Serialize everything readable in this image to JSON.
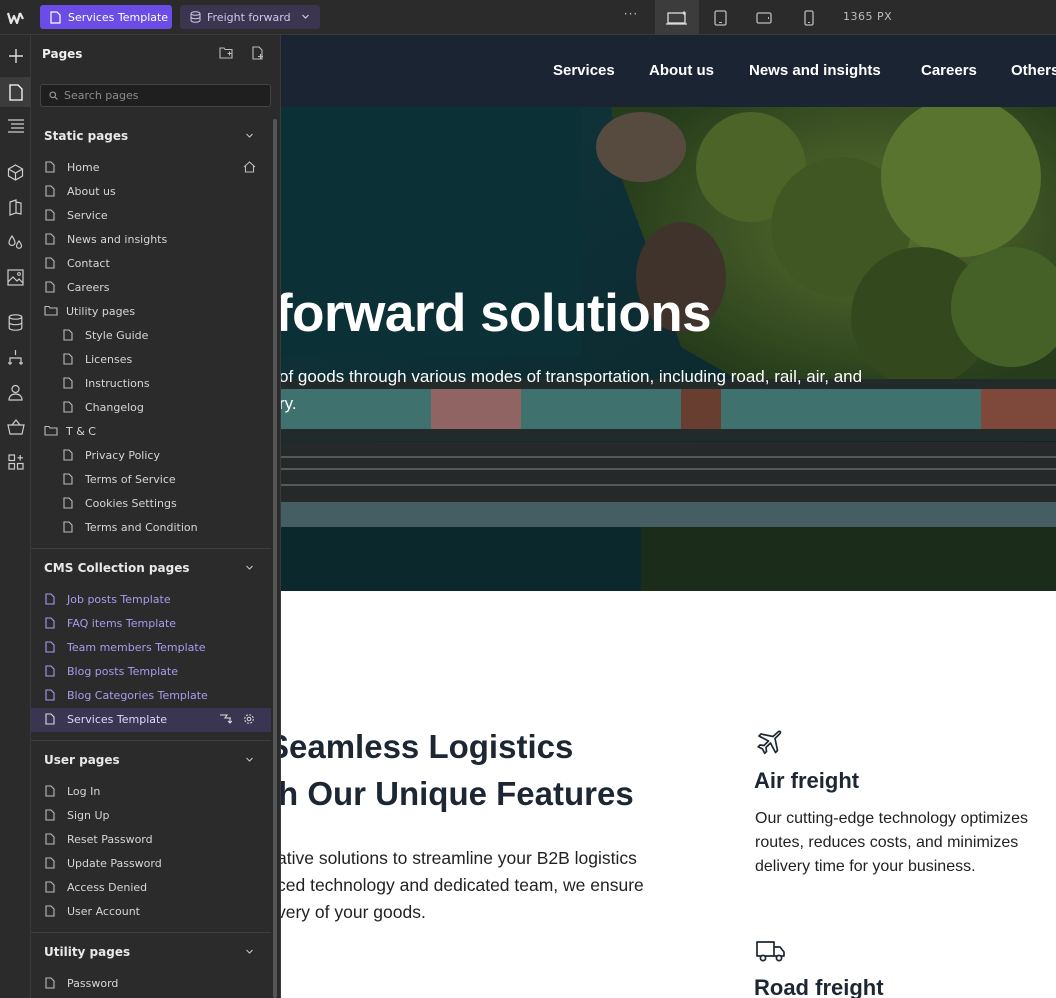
{
  "topbar": {
    "template_label": "Services Template",
    "collection_label": "Freight forward",
    "more_label": "···",
    "width_readout": "1365 PX"
  },
  "panel": {
    "title": "Pages",
    "search_placeholder": "Search pages",
    "sections": {
      "static": {
        "title": "Static pages",
        "items": [
          "Home",
          "About us",
          "Service",
          "News and insights",
          "Contact",
          "Careers"
        ],
        "utility_folder": "Utility pages",
        "utility_items": [
          "Style Guide",
          "Licenses",
          "Instructions",
          "Changelog"
        ],
        "tc_folder": "T & C",
        "tc_items": [
          "Privacy Policy",
          "Terms of Service",
          "Cookies Settings",
          "Terms and Condition"
        ]
      },
      "cms": {
        "title": "CMS Collection pages",
        "items": [
          "Job posts Template",
          "FAQ items Template",
          "Team members Template",
          "Blog posts Template",
          "Blog Categories Template",
          "Services Template"
        ]
      },
      "user": {
        "title": "User pages",
        "items": [
          "Log In",
          "Sign Up",
          "Reset Password",
          "Update Password",
          "Access Denied",
          "User Account"
        ]
      },
      "utility": {
        "title": "Utility pages",
        "items": [
          "Password"
        ]
      }
    }
  },
  "site": {
    "nav": [
      "Services",
      "About us",
      "News and insights",
      "Careers",
      "Others"
    ],
    "hero": {
      "title": "forward solutions",
      "subtitle_line1": "of goods through various modes of transportation, including road, rail, air, and",
      "subtitle_line2": "ry."
    },
    "features": {
      "title_line1": "Seamless Logistics",
      "title_line2": "th Our Unique Features",
      "body_line1": "ative solutions to streamline your B2B logistics",
      "body_line2": "ced technology and dedicated team, we ensure",
      "body_line3": "very of your goods."
    },
    "cards": [
      {
        "icon": "airplane-icon",
        "title": "Air freight",
        "body": "Our cutting-edge technology optimizes routes, reduces costs, and minimizes delivery time for your business."
      },
      {
        "icon": "truck-icon",
        "title": "Road freight"
      }
    ]
  },
  "colors": {
    "accent": "#6b4ce6",
    "cms_link": "#a99bf0",
    "site_nav_bg": "#1a2433",
    "heading": "#1d2733"
  }
}
